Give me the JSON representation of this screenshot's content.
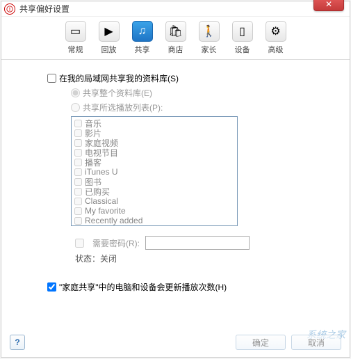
{
  "title": "共享偏好设置",
  "toolbar": [
    {
      "id": "general",
      "label": "常规",
      "icon": "▭"
    },
    {
      "id": "playback",
      "label": "回放",
      "icon": "▶"
    },
    {
      "id": "sharing",
      "label": "共享",
      "icon": "♫",
      "active": true
    },
    {
      "id": "store",
      "label": "商店",
      "icon": "🛍"
    },
    {
      "id": "parental",
      "label": "家长",
      "icon": "🚶"
    },
    {
      "id": "devices",
      "label": "设备",
      "icon": "▯"
    },
    {
      "id": "advanced",
      "label": "高级",
      "icon": "⚙"
    }
  ],
  "share_lan_label": "在我的局域网共享我的资料库(S)",
  "share_entire_label": "共享整个资料库(E)",
  "share_selected_label": "共享所选播放列表(P):",
  "playlists": [
    "音乐",
    "影片",
    "家庭视频",
    "电视节目",
    "播客",
    "iTunes U",
    "图书",
    "已购买",
    "Classical",
    "My favorite",
    "Recently added"
  ],
  "require_password_label": "需要密码(R):",
  "status_label": "状态：",
  "status_value": "关闭",
  "home_sharing_label": "\"家庭共享\"中的电脑和设备会更新播放次数(H)",
  "help_label": "?",
  "btn_ok": "确定",
  "btn_cancel": "取消",
  "watermark": "系统之家"
}
